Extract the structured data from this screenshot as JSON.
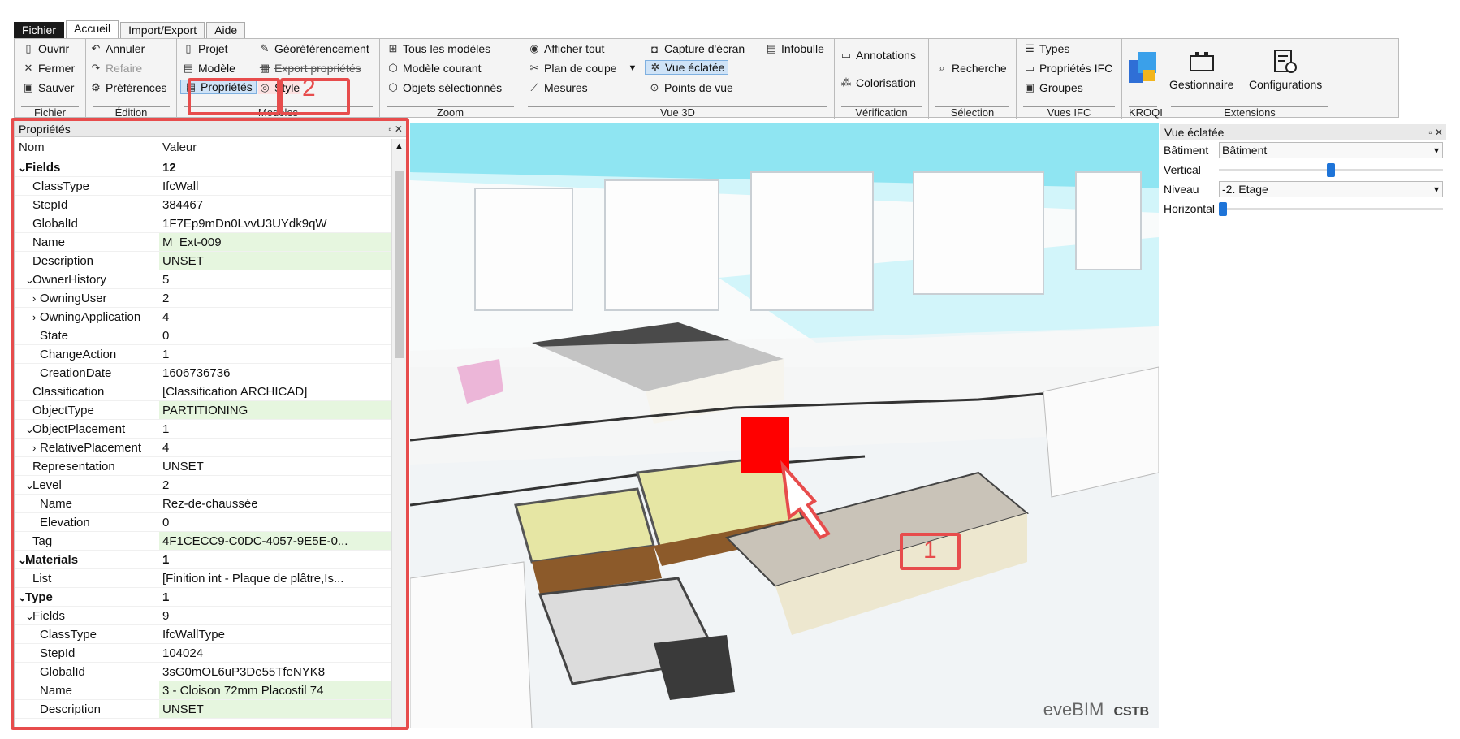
{
  "menu": {
    "tabs": [
      "Fichier",
      "Accueil",
      "Import/Export",
      "Aide"
    ]
  },
  "ribbon": {
    "fichier": {
      "label": "Fichier",
      "ouvrir": "Ouvrir",
      "fermer": "Fermer",
      "sauver": "Sauver"
    },
    "edition": {
      "label": "Édition",
      "annuler": "Annuler",
      "refaire": "Refaire",
      "preferences": "Préférences"
    },
    "modeles": {
      "label": "Modèles",
      "projet": "Projet",
      "modele": "Modèle",
      "proprietes": "Propriétés",
      "georef": "Géoréférencement",
      "export": "Export propriétés",
      "style": "Style"
    },
    "zoom": {
      "label": "Zoom",
      "tous": "Tous les modèles",
      "courant": "Modèle courant",
      "selection": "Objets sélectionnés"
    },
    "vue3d": {
      "label": "Vue 3D",
      "afficher": "Afficher tout",
      "plan": "Plan de coupe",
      "mesures": "Mesures",
      "capture": "Capture d'écran",
      "eclatee": "Vue éclatée",
      "points": "Points de vue",
      "infobulle": "Infobulle"
    },
    "verification": {
      "label": "Vérification",
      "annotations": "Annotations",
      "colorisation": "Colorisation"
    },
    "selection": {
      "label": "Sélection",
      "recherche": "Recherche"
    },
    "vuesifc": {
      "label": "Vues IFC",
      "types": "Types",
      "proprietes": "Propriétés IFC",
      "groupes": "Groupes"
    },
    "kroqi": {
      "label": "KROQI"
    },
    "extensions": {
      "label": "Extensions",
      "gestionnaire": "Gestionnaire",
      "configurations": "Configurations"
    }
  },
  "properties": {
    "title": "Propriétés",
    "header": {
      "name": "Nom",
      "value": "Valeur"
    },
    "rows": [
      {
        "name": "Fields",
        "value": "12",
        "indent": 0,
        "expand": "v",
        "bold": true
      },
      {
        "name": "ClassType",
        "value": "IfcWall",
        "indent": 1
      },
      {
        "name": "StepId",
        "value": "384467",
        "indent": 1
      },
      {
        "name": "GlobalId",
        "value": "1F7Ep9mDn0LvvU3UYdk9qW",
        "indent": 1
      },
      {
        "name": "Name",
        "value": "M_Ext-009",
        "indent": 1,
        "edit": true
      },
      {
        "name": "Description",
        "value": "UNSET",
        "indent": 1,
        "edit": true
      },
      {
        "name": "OwnerHistory",
        "value": "5",
        "indent": 1,
        "expand": "v"
      },
      {
        "name": "OwningUser",
        "value": "2",
        "indent": 2,
        "expand": ">"
      },
      {
        "name": "OwningApplication",
        "value": "4",
        "indent": 2,
        "expand": ">"
      },
      {
        "name": "State",
        "value": "0",
        "indent": 2
      },
      {
        "name": "ChangeAction",
        "value": "1",
        "indent": 2
      },
      {
        "name": "CreationDate",
        "value": "1606736736",
        "indent": 2
      },
      {
        "name": "Classification",
        "value": "[Classification ARCHICAD]",
        "indent": 1
      },
      {
        "name": "ObjectType",
        "value": "PARTITIONING",
        "indent": 1,
        "edit": true
      },
      {
        "name": "ObjectPlacement",
        "value": "1",
        "indent": 1,
        "expand": "v"
      },
      {
        "name": "RelativePlacement",
        "value": "4",
        "indent": 2,
        "expand": ">"
      },
      {
        "name": "Representation",
        "value": "UNSET",
        "indent": 1
      },
      {
        "name": "Level",
        "value": "2",
        "indent": 1,
        "expand": "v"
      },
      {
        "name": "Name",
        "value": "Rez-de-chaussée",
        "indent": 2
      },
      {
        "name": "Elevation",
        "value": "0",
        "indent": 2
      },
      {
        "name": "Tag",
        "value": "4F1CECC9-C0DC-4057-9E5E-0...",
        "indent": 1,
        "edit": true
      },
      {
        "name": "Materials",
        "value": "1",
        "indent": 0,
        "expand": "v",
        "bold": true
      },
      {
        "name": "List",
        "value": "[Finition int - Plaque de plâtre,Is...",
        "indent": 1
      },
      {
        "name": "Type",
        "value": "1",
        "indent": 0,
        "expand": "v",
        "bold": true
      },
      {
        "name": "Fields",
        "value": "9",
        "indent": 1,
        "expand": "v"
      },
      {
        "name": "ClassType",
        "value": "IfcWallType",
        "indent": 2
      },
      {
        "name": "StepId",
        "value": "104024",
        "indent": 2
      },
      {
        "name": "GlobalId",
        "value": "3sG0mOL6uP3De55TfeNYK8",
        "indent": 2
      },
      {
        "name": "Name",
        "value": "3 - Cloison 72mm Placostil 74",
        "indent": 2,
        "edit": true
      },
      {
        "name": "Description",
        "value": "UNSET",
        "indent": 2,
        "edit": true
      }
    ]
  },
  "exploded": {
    "title": "Vue éclatée",
    "batiment_label": "Bâtiment",
    "batiment_value": "Bâtiment",
    "vertical_label": "Vertical",
    "vertical_value": 0.5,
    "niveau_label": "Niveau",
    "niveau_value": "-2. Etage",
    "horizontal_label": "Horizontal",
    "horizontal_value": 0.0
  },
  "viewport": {
    "brand": "eveBIM",
    "org": "CSTB"
  },
  "callouts": {
    "one": "1",
    "two": "2"
  },
  "colors": {
    "highlight": "#e74c4c",
    "selected_wall": "#ff0000",
    "water": "#8fe5f2",
    "slab": "#e4e4a0"
  }
}
